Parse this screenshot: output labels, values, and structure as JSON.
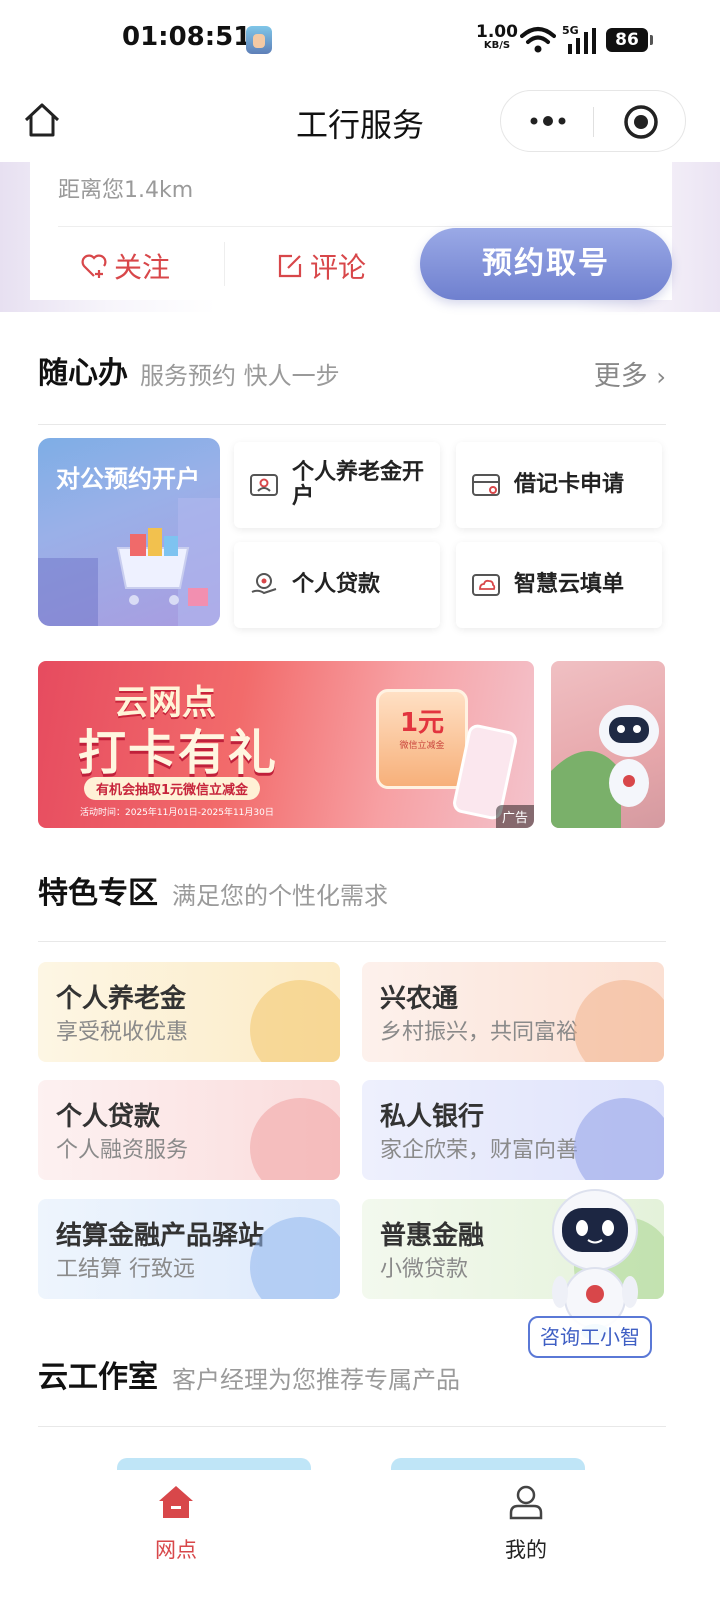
{
  "status_bar": {
    "time": "01:08:51",
    "net_speed": "1.00",
    "net_unit": "KB/S",
    "network_type": "5G",
    "battery": "86"
  },
  "nav": {
    "title": "工行服务",
    "icons": {
      "home": "home-icon",
      "more": "more-dots-icon",
      "close": "target-close-icon"
    }
  },
  "branch": {
    "distance": "距离您1.4km",
    "follow_label": "关注",
    "comment_label": "评论",
    "reserve_label": "预约取号"
  },
  "quick_section": {
    "title": "随心办",
    "subtitle": "服务预约 快人一步",
    "more_label": "更多",
    "promo_label": "对公预约开户",
    "items": [
      {
        "label": "个人养老金开户",
        "icon": "id-card-icon"
      },
      {
        "label": "借记卡申请",
        "icon": "bank-card-icon"
      },
      {
        "label": "个人贷款",
        "icon": "loan-hand-icon"
      },
      {
        "label": "智慧云填单",
        "icon": "cloud-form-icon"
      }
    ]
  },
  "banner": {
    "title_line1": "云网点",
    "title_line2": "打卡有礼",
    "pill": "有机会抽取1元微信立减金",
    "date": "活动时间：2025年11月01日-2025年11月30日",
    "coupon_value": "1元",
    "coupon_sub": "微信立减金",
    "ad_tag": "广告"
  },
  "feature_section": {
    "title": "特色专区",
    "subtitle": "满足您的个性化需求",
    "items": [
      {
        "title": "个人养老金",
        "sub": "享受税收优惠",
        "accent": "#f3c76b"
      },
      {
        "title": "兴农通",
        "sub": "乡村振兴，共同富裕",
        "accent": "#f2b38d"
      },
      {
        "title": "个人贷款",
        "sub": "个人融资服务",
        "accent": "#f1a2a2"
      },
      {
        "title": "私人银行",
        "sub": "家企欣荣，财富向善",
        "accent": "#8f9ee8"
      },
      {
        "title": "结算金融产品驿站",
        "sub": "工结算 行致远",
        "accent": "#8fb6ef"
      },
      {
        "title": "普惠金融",
        "sub": "小微贷款",
        "accent": "#a7d58e"
      }
    ]
  },
  "assistant": {
    "label": "咨询工小智"
  },
  "studio_section": {
    "title": "云工作室",
    "subtitle": "客户经理为您推荐专属产品"
  },
  "tab_bar": {
    "tabs": [
      {
        "label": "网点",
        "icon": "home-tab-icon",
        "active": true
      },
      {
        "label": "我的",
        "icon": "user-icon",
        "active": false
      }
    ],
    "active_color": "#d8474a"
  }
}
